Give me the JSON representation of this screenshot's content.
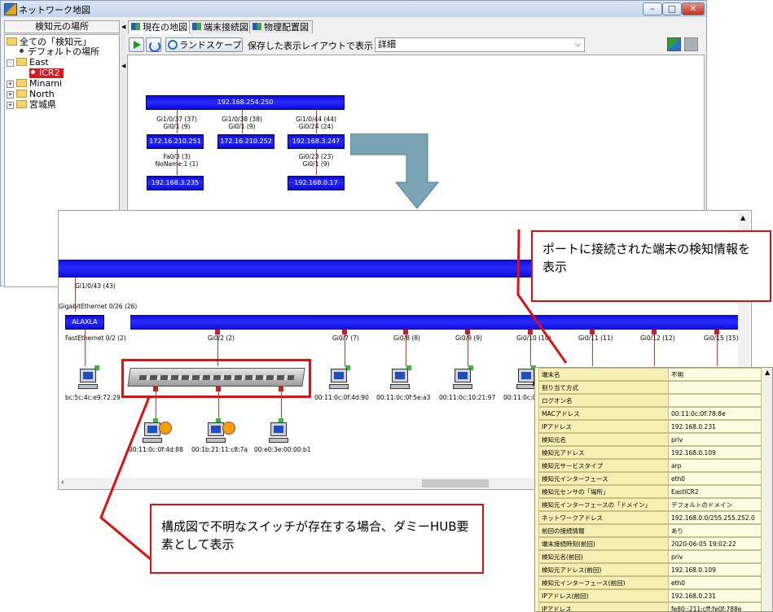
{
  "window": {
    "title": "ネットワーク地図"
  },
  "left_panel": {
    "header": "検知元の場所",
    "tree": [
      {
        "label": "全ての「検知元」",
        "kind": "folder",
        "expander": ""
      },
      {
        "label": "デフォルトの場所",
        "kind": "dot",
        "expander": ""
      },
      {
        "label": "East",
        "kind": "folder",
        "expander": "-"
      },
      {
        "label": "ICR2",
        "kind": "selected",
        "expander": ""
      },
      {
        "label": "Minami",
        "kind": "folder",
        "expander": "+"
      },
      {
        "label": "North",
        "kind": "folder",
        "expander": "+"
      },
      {
        "label": "宮城県",
        "kind": "folder",
        "expander": "+"
      }
    ]
  },
  "tabs": [
    {
      "label": "現在の地図",
      "active": true
    },
    {
      "label": "端末接続図",
      "active": false
    },
    {
      "label": "物理配置図",
      "active": false
    }
  ],
  "toolbar": {
    "landscape_label": "ランドスケープ",
    "layout_label": "保存した表示レイアウトで表示",
    "detail_value": "詳細"
  },
  "topology": {
    "core_ip": "192.168.254.250",
    "links": [
      {
        "a": "Gi1/0/37 (37)",
        "b": "Gi0/1 (9)",
        "ip": "172.16.210.251"
      },
      {
        "a": "Gi1/0/38 (38)",
        "b": "Gi0/1 (9)",
        "ip": "172.16.210.252"
      },
      {
        "a": "Gi1/0/44 (44)",
        "b": "Gi0/24 (24)",
        "ip": "192.168.3.247"
      }
    ],
    "sub1_a": "Fa0/3 (3)",
    "sub1_b": "NoName:1 (1)",
    "sub1_ip": "192.168.3.235",
    "sub2_a": "Gi0/23 (23)",
    "sub2_b": "Gi0/1 (9)",
    "sub2_ip": "192.168.0.17"
  },
  "zoom": {
    "uplink_port": "Gi1/0/43 (43)",
    "switch_port": "GigabitEthernet 0/26 (26)",
    "switch_name": "ALAXLA",
    "fast_port": "FastEthernet 0/2 (2)",
    "ports": [
      "Gi0/2 (2)",
      "Gi0/7 (7)",
      "Gi0/8 (8)",
      "Gi0/9 (9)",
      "Gi0/10 (10)",
      "Gi0/11 (11)",
      "Gi0/12 (12)",
      "Gi0/15 (15)"
    ],
    "terminals": [
      "bc:5c:4c:e9:72:29",
      "00:11:0c:0f:4d:90",
      "00:11:0c:0f:5e:a3",
      "00:11:0c:10:21:97",
      "00:11:0c:0f:"
    ],
    "hub_terminals": [
      "00:11:0c:0f:4d:88",
      "00:1b:21:11:c8:7a",
      "00:e0:3e:00:00:b1"
    ]
  },
  "properties": [
    {
      "k": "端末名",
      "v": "不明"
    },
    {
      "k": "割り当て方式",
      "v": ""
    },
    {
      "k": "ログオン名",
      "v": ""
    },
    {
      "k": "MACアドレス",
      "v": "00:11:0c:0f:78:8e"
    },
    {
      "k": "IPアドレス",
      "v": "192.168.0.231"
    },
    {
      "k": "検知元名",
      "v": "priv"
    },
    {
      "k": "検知元アドレス",
      "v": "192.168.0.109"
    },
    {
      "k": "検知元サービスタイプ",
      "v": "arp"
    },
    {
      "k": "検知元インターフェース",
      "v": "eth0"
    },
    {
      "k": "検知元センサの「場所」",
      "v": "EastICR2"
    },
    {
      "k": "検知元インターフェースの「ドメイン」",
      "v": "デフォルトのドメイン"
    },
    {
      "k": "ネットワークアドレス",
      "v": "192.168.0.0/255.255.252.0"
    },
    {
      "k": "前回の接続情報",
      "v": "あり"
    },
    {
      "k": "端末接続時刻(前回)",
      "v": "2020-06-05 19:02:22"
    },
    {
      "k": "検知元名(前回)",
      "v": "priv"
    },
    {
      "k": "検知元アドレス(前回)",
      "v": "192.168.0.109"
    },
    {
      "k": "検知元インターフェース(前回)",
      "v": "eth0"
    },
    {
      "k": "IPアドレス(前回)",
      "v": "192.168.0.231"
    },
    {
      "k": "IPアドレス",
      "v": "fe80::211:cff:fe0f:788e"
    }
  ],
  "callouts": {
    "top": "ポートに接続された端末の検知情報を表示",
    "bottom": "構成図で不明なスイッチが存在する場合、ダミーHUB要素として表示"
  },
  "colors": {
    "switch": "#1a1aff",
    "callout_border": "#e01010",
    "arrow": "#7ba3b6",
    "selected": "#d21c1c"
  }
}
